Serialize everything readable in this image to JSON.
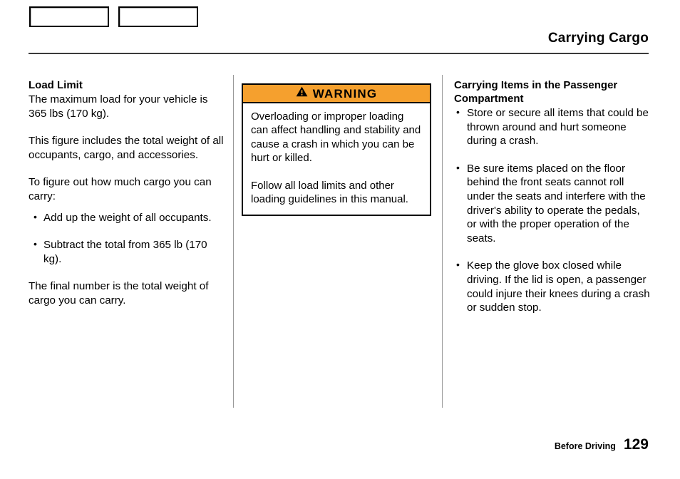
{
  "header": {
    "title": "Carrying Cargo",
    "tab_boxes": [
      "",
      ""
    ]
  },
  "left_column": {
    "heading": "Load Limit",
    "paragraph_1": "The maximum load for your vehicle is 365 lbs (170 kg).",
    "paragraph_2": "This figure includes the total weight of all occupants, cargo, and accessories.",
    "paragraph_3": "To figure out how much cargo you can carry:",
    "bullets": [
      "Add up the weight of all occupants.",
      "Subtract the total from 365 lb (170 kg)."
    ],
    "paragraph_4": "The final number is the total weight of cargo you can carry."
  },
  "warning": {
    "label": "WARNING",
    "icon": "warning-triangle-icon",
    "header_color": "#f5a02e",
    "paragraph_1": "Overloading or improper loading can affect handling and stability and cause a crash in which you can be hurt or killed.",
    "paragraph_2": "Follow all load limits and other loading guidelines in this manual."
  },
  "right_column": {
    "heading": "Carrying Items in the Passenger Compartment",
    "bullets": [
      "Store or secure all items that could be thrown around and hurt someone during a crash.",
      "Be sure items placed on the floor behind the front seats cannot roll under the seats and interfere with the driver's ability to operate the pedals, or with the proper operation of the seats.",
      "Keep the glove box closed while driving. If the lid is open, a passenger could injure their knees during a crash or sudden stop."
    ]
  },
  "footer": {
    "section": "Before Driving",
    "page_number": "129"
  }
}
